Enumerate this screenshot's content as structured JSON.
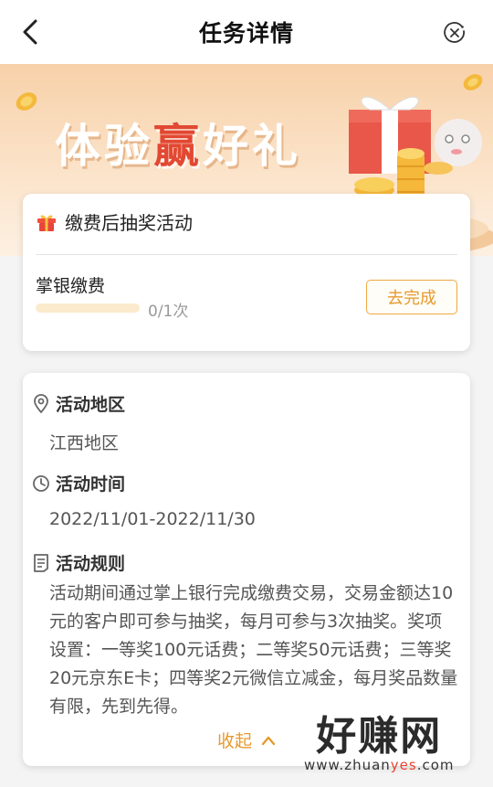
{
  "header": {
    "title": "任务详情",
    "back_icon": "chevron-left-icon",
    "close_icon": "close-circle-icon"
  },
  "banner": {
    "title_pre": "体验",
    "title_highlight": "赢",
    "title_post": "好礼",
    "colors": {
      "highlight": "#e24832",
      "background": "#f7d1a9"
    }
  },
  "task_card": {
    "title": "缴费后抽奖活动",
    "icon": "gift-icon",
    "task": {
      "name": "掌银缴费",
      "progress_text": "0/1次",
      "progress_fraction": 0,
      "action_label": "去完成"
    }
  },
  "info_card": {
    "region": {
      "label": "活动地区",
      "value": "江西地区",
      "icon": "location-pin-icon"
    },
    "time": {
      "label": "活动时间",
      "value": "2022/11/01-2022/11/30",
      "icon": "clock-icon"
    },
    "rules": {
      "label": "活动规则",
      "icon": "document-icon",
      "text": "活动期间通过掌上银行完成缴费交易，交易金额达10元的客户即可参与抽奖，每月可参与3次抽奖。奖项设置：一等奖100元话费；二等奖50元话费；三等奖20元京东E卡；四等奖2元微信立减金，每月奖品数量有限，先到先得。"
    },
    "collapse_label": "收起"
  },
  "watermark": {
    "main": "好赚网",
    "sub_pre": "www.zhuan",
    "sub_accent": "yes",
    "sub_post": ".com"
  },
  "colors": {
    "accent": "#e69a2e",
    "progress_track": "#fbeacc"
  }
}
